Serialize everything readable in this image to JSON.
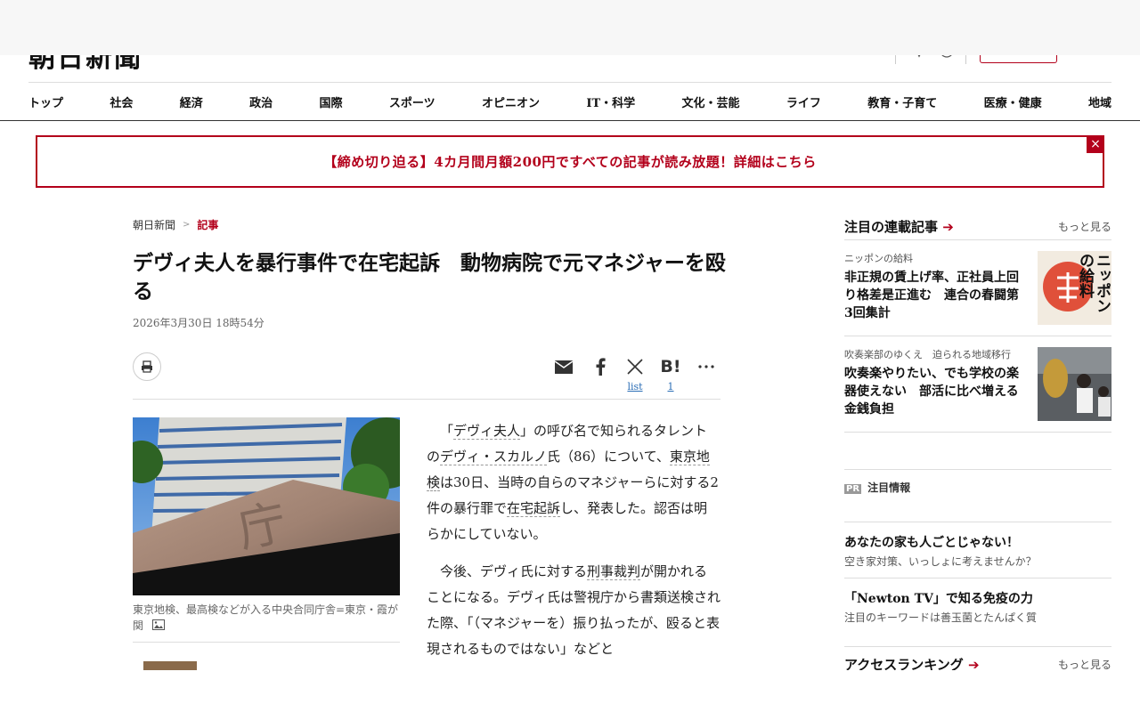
{
  "header": {
    "logo_text": "朝日新聞"
  },
  "nav": {
    "items": [
      "トップ",
      "社会",
      "経済",
      "政治",
      "国際",
      "スポーツ",
      "オピニオン",
      "IT・科学",
      "文化・芸能",
      "ライフ",
      "教育・子育て",
      "医療・健康",
      "地域"
    ]
  },
  "banner": {
    "text": "【締め切り迫る】4カ月間月額200円ですべての記事が読み放題！詳細はこちら",
    "close": "×"
  },
  "breadcrumb": {
    "home": "朝日新聞",
    "sep": ">",
    "current": "記事"
  },
  "article": {
    "headline": "デヴィ夫人を暴行事件で在宅起訴　動物病院で元マネジャーを殴る",
    "timestamp": "2026年3月30日 18時54分",
    "share": {
      "x_count": "list",
      "hatena_count": "1"
    },
    "photo_caption": "東京地検、最高検などが入る中央合同庁舎=東京・霞が関",
    "p1": {
      "a": "「",
      "k1": "デヴィ夫人",
      "b": "」の呼び名で知られるタレントの",
      "k2": "デヴィ・スカルノ",
      "c": "氏（86）について、",
      "k3": "東京地検",
      "d": "は30日、当時の自らのマネジャーらに対する2件の暴行罪で",
      "k4": "在宅起訴",
      "e": "し、発表した。認否は明らかにしていない。"
    },
    "p2": {
      "a": "今後、デヴィ氏に対する",
      "k1": "刑事裁判",
      "b": "が開かれることになる。デヴィ氏は警視庁から書類送検された際、「（マネジャーを）振り払ったが、殴ると表現されるものではない」などと"
    }
  },
  "sidebar": {
    "series": {
      "title": "注目の連載記事",
      "more": "もっと見る",
      "items": [
        {
          "label": "ニッポンの給料",
          "title": "非正規の賃上げ率、正社員上回り格差是正進む　連合の春闘第3回集計",
          "thumb_text": "ニッポンの給料"
        },
        {
          "label": "吹奏楽部のゆくえ　迫られる地域移行",
          "title": "吹奏楽やりたい、でも学校の楽器使えない　部活に比べ増える金銭負担"
        }
      ]
    },
    "pr": {
      "badge": "PR",
      "title": "注目情報",
      "items": [
        {
          "title": "あなたの家も人ごとじゃない！",
          "sub": "空き家対策、いっしょに考えませんか？"
        },
        {
          "title": "「Newton TV」で知る免疫の力",
          "sub": "注目のキーワードは善玉菌とたんぱく質"
        }
      ]
    },
    "ranking": {
      "title": "アクセスランキング",
      "more": "もっと見る"
    }
  },
  "colors": {
    "accent": "#b3001b",
    "link": "#2a6db5"
  }
}
